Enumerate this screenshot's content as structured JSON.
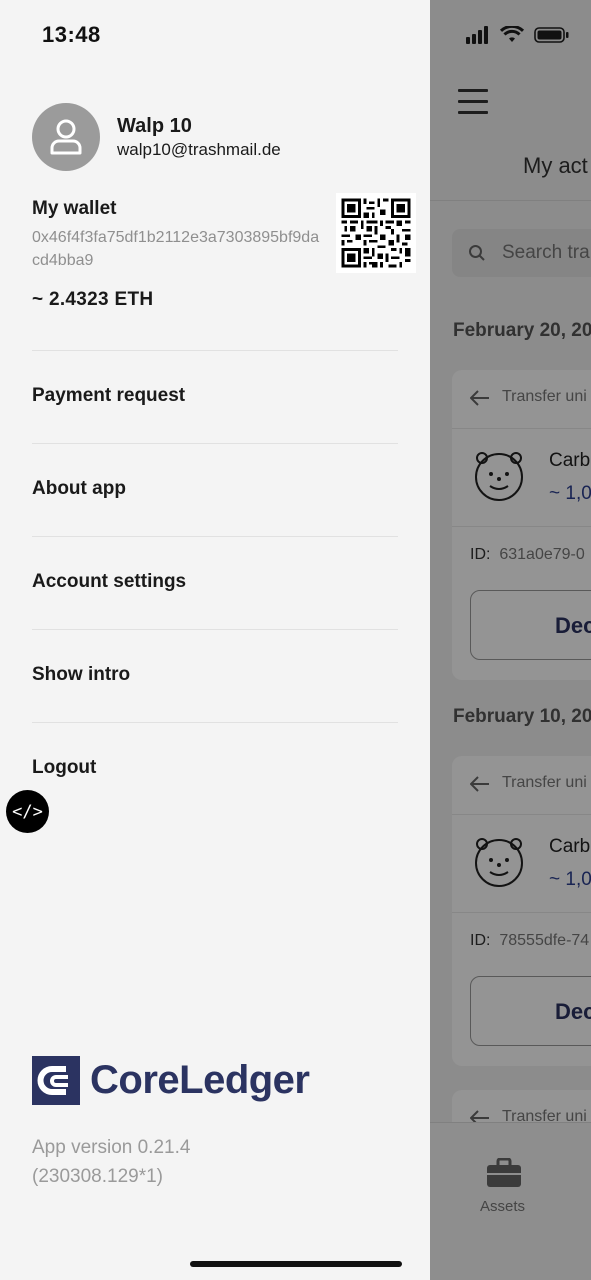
{
  "status_bar": {
    "time": "13:48"
  },
  "profile": {
    "name": "Walp 10",
    "email": "walp10@trashmail.de",
    "avatar_icon": "user-icon"
  },
  "wallet": {
    "title": "My wallet",
    "address": "0x46f4f3fa75df1b2112e3a7303895bf9dacd4bba9",
    "balance": "~ 2.4323 ETH",
    "qr_icon": "qr-code-icon"
  },
  "menu": [
    {
      "label": "Payment request"
    },
    {
      "label": "About app"
    },
    {
      "label": "Account settings"
    },
    {
      "label": "Show intro"
    },
    {
      "label": "Logout"
    }
  ],
  "dev_badge": "</>",
  "brand": {
    "name": "CoreLedger",
    "color": "#2b3361"
  },
  "version": {
    "line1": "App version 0.21.4",
    "line2": "(230308.129*1)"
  },
  "background_screen": {
    "title": "My act",
    "search_placeholder": "Search tra",
    "groups": [
      {
        "date": "February 20, 20",
        "card": {
          "header": "Transfer uni",
          "name": "Carb",
          "amount": "~ 1,0",
          "id_label": "ID:",
          "id_value": "631a0e79-0",
          "button": "Dec"
        }
      },
      {
        "date": "February 10, 20",
        "card": {
          "header": "Transfer uni",
          "name": "Carb",
          "amount": "~ 1,0",
          "id_label": "ID:",
          "id_value": "78555dfe-74",
          "button": "Dec"
        }
      }
    ],
    "third_card_header": "Transfer uni",
    "tab_assets": "Assets"
  }
}
